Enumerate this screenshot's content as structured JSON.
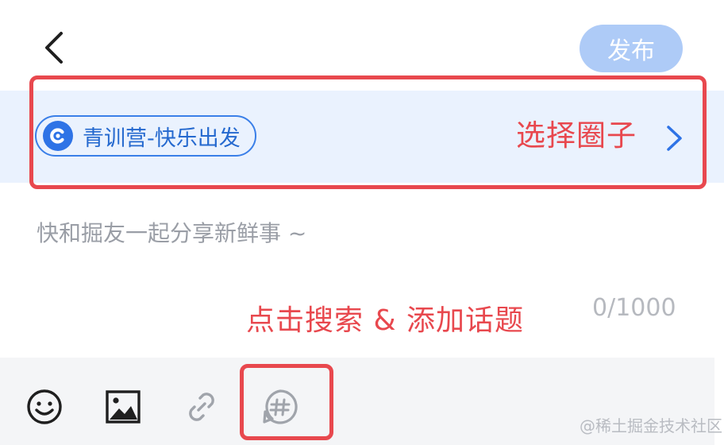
{
  "header": {
    "back_icon": "chevron-left-icon",
    "publish_label": "发布"
  },
  "circle": {
    "selected_name": "青训营-快乐出发",
    "selected_icon": "circle-logo-icon",
    "annotation_label": "选择圈子",
    "chevron_icon": "chevron-right-icon"
  },
  "editor": {
    "placeholder": "快和掘友一起分享新鲜事 ~",
    "char_count": "0/1000"
  },
  "topic_hint": "点击搜索 & 添加话题",
  "toolbar": {
    "items": [
      {
        "name": "emoji",
        "icon": "smiley-icon"
      },
      {
        "name": "image",
        "icon": "image-icon"
      },
      {
        "name": "link",
        "icon": "link-icon"
      },
      {
        "name": "topic",
        "icon": "hashtag-icon"
      }
    ]
  },
  "watermark": "@稀土掘金技术社区",
  "colors": {
    "annotation_red": "#e8484e",
    "publish_disabled": "#aecbf7",
    "circle_blue": "#2e73e6",
    "circle_bar_bg": "#eaf2fe"
  }
}
